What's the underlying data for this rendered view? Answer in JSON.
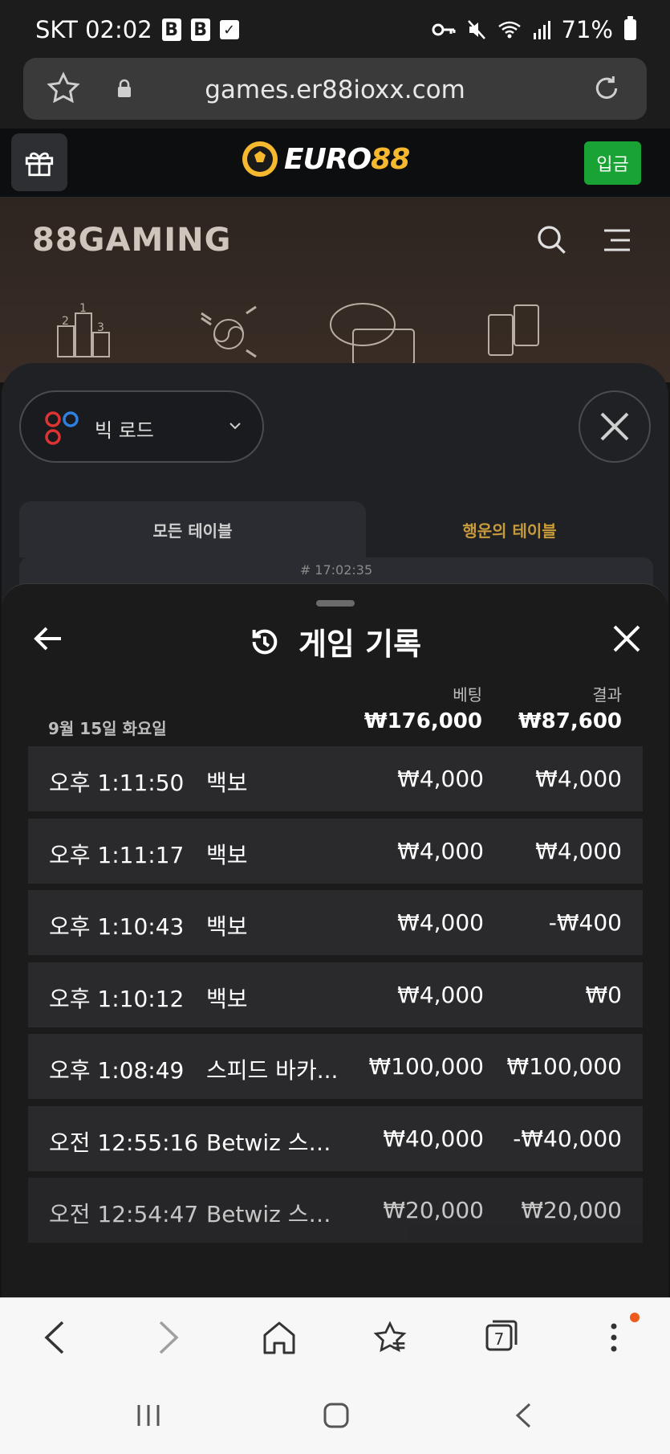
{
  "status_bar": {
    "carrier_time": "SKT 02:02",
    "badge_1": "B",
    "badge_2": "B",
    "battery": "71%"
  },
  "browser": {
    "url": "games.er88ioxx.com",
    "tab_count": "7"
  },
  "site_header": {
    "logo_part1": "EURO",
    "logo_part2": "88",
    "deposit_label": "입금"
  },
  "lobby": {
    "brand": "88GAMING"
  },
  "road_panel": {
    "road_select_label": "빅 로드",
    "tab_all": "모든 테이블",
    "tab_lucky": "행운의 테이블",
    "timestamp": "# 17:02:35"
  },
  "history": {
    "title": "게임 기록",
    "col_bet": "베팅",
    "col_result": "결과",
    "day": "9월 15일 화요일",
    "total_bet": "₩176,000",
    "total_result": "₩87,600",
    "rows": [
      {
        "time": "오후 1:11:50",
        "game": "백보",
        "bet": "₩4,000",
        "result": "₩4,000"
      },
      {
        "time": "오후 1:11:17",
        "game": "백보",
        "bet": "₩4,000",
        "result": "₩4,000"
      },
      {
        "time": "오후 1:10:43",
        "game": "백보",
        "bet": "₩4,000",
        "result": "-₩400"
      },
      {
        "time": "오후 1:10:12",
        "game": "백보",
        "bet": "₩4,000",
        "result": "₩0"
      },
      {
        "time": "오후 1:08:49",
        "game": "스피드 바카...",
        "bet": "₩100,000",
        "result": "₩100,000"
      },
      {
        "time": "오전 12:55:16",
        "game": "Betwiz 스피...",
        "bet": "₩40,000",
        "result": "-₩40,000"
      },
      {
        "time": "오전 12:54:47",
        "game": "Betwiz 스피...",
        "bet": "₩20,000",
        "result": "₩20,000"
      }
    ]
  },
  "colors": {
    "deposit_green": "#1aa335",
    "gold": "#f5b82e",
    "lucky_tab": "#c79a3a",
    "notification": "#f05a1a"
  }
}
